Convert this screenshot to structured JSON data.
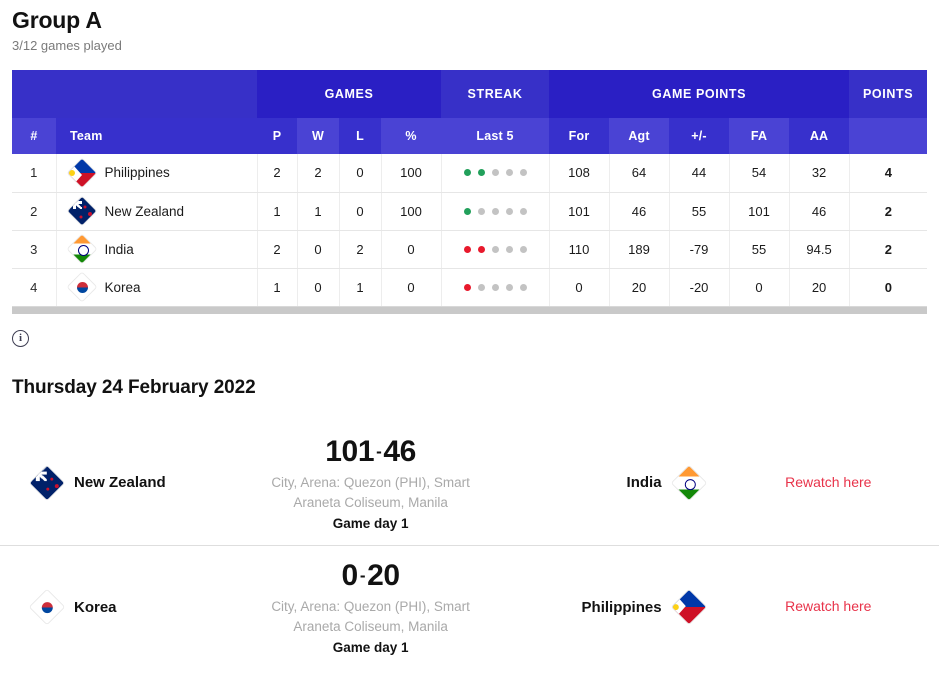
{
  "header": {
    "title": "Group A",
    "subtitle": "3/12 games played"
  },
  "standings": {
    "group_headers": {
      "blank": "",
      "games": "GAMES",
      "streak": "STREAK",
      "game_points": "GAME POINTS",
      "points": "POINTS"
    },
    "sub_headers": {
      "rank": "#",
      "team": "Team",
      "p": "P",
      "w": "W",
      "l": "L",
      "pct": "%",
      "last5": "Last 5",
      "for": "For",
      "agt": "Agt",
      "plusminus": "+/-",
      "fa": "FA",
      "aa": "AA",
      "points": ""
    },
    "rows": [
      {
        "rank": "1",
        "team": "Philippines",
        "flag": "flag-ph",
        "p": "2",
        "w": "2",
        "l": "0",
        "pct": "100",
        "last5": [
          "w",
          "w",
          "n",
          "n",
          "n"
        ],
        "for": "108",
        "agt": "64",
        "plusminus": "44",
        "fa": "54",
        "aa": "32",
        "points": "4"
      },
      {
        "rank": "2",
        "team": "New Zealand",
        "flag": "flag-nz",
        "p": "1",
        "w": "1",
        "l": "0",
        "pct": "100",
        "last5": [
          "w",
          "n",
          "n",
          "n",
          "n"
        ],
        "for": "101",
        "agt": "46",
        "plusminus": "55",
        "fa": "101",
        "aa": "46",
        "points": "2"
      },
      {
        "rank": "3",
        "team": "India",
        "flag": "flag-in",
        "p": "2",
        "w": "0",
        "l": "2",
        "pct": "0",
        "last5": [
          "l",
          "l",
          "n",
          "n",
          "n"
        ],
        "for": "110",
        "agt": "189",
        "plusminus": "-79",
        "fa": "55",
        "aa": "94.5",
        "points": "2"
      },
      {
        "rank": "4",
        "team": "Korea",
        "flag": "flag-kr",
        "p": "1",
        "w": "0",
        "l": "1",
        "pct": "0",
        "last5": [
          "l",
          "n",
          "n",
          "n",
          "n"
        ],
        "for": "0",
        "agt": "20",
        "plusminus": "-20",
        "fa": "0",
        "aa": "20",
        "points": "0"
      }
    ]
  },
  "info": {
    "icon_label": "i"
  },
  "date_heading": "Thursday 24 February 2022",
  "matches": [
    {
      "home_team": "New Zealand",
      "home_flag": "flag-nz",
      "away_team": "India",
      "away_flag": "flag-in",
      "home_score": "101",
      "separator": "-",
      "away_score": "46",
      "venue": "City, Arena: Quezon (PHI), Smart Araneta Coliseum, Manila",
      "game_day": "Game day 1",
      "rewatch": "Rewatch here"
    },
    {
      "home_team": "Korea",
      "home_flag": "flag-kr",
      "away_team": "Philippines",
      "away_flag": "flag-ph",
      "home_score": "0",
      "separator": "-",
      "away_score": "20",
      "venue": "City, Arena: Quezon (PHI), Smart Araneta Coliseum, Manila",
      "game_day": "Game day 1",
      "rewatch": "Rewatch here"
    }
  ],
  "colors": {
    "header_dark": "#2a1fc4",
    "header_mid": "#3730c8",
    "subheader_light": "#4a43d4",
    "win_dot": "#22a05b",
    "loss_dot": "#e8192c",
    "empty_dot": "#c3c3c3",
    "rewatch_link": "#e8334a"
  }
}
